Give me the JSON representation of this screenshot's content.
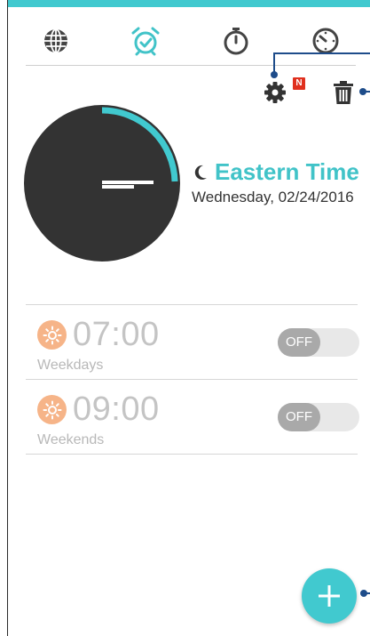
{
  "tabs": [
    {
      "icon": "globe-icon",
      "active": false
    },
    {
      "icon": "alarm-clock-icon",
      "active": true
    },
    {
      "icon": "stopwatch-icon",
      "active": false
    },
    {
      "icon": "timer-icon",
      "active": false
    }
  ],
  "toolbar": {
    "settings_icon": "gear-icon",
    "settings_badge": "N",
    "delete_icon": "trash-icon"
  },
  "clock": {
    "city_icon": "moon-icon",
    "city_name": "Eastern Time",
    "date": "Wednesday, 02/24/2016"
  },
  "alarms": [
    {
      "time": "07:00",
      "label": "Weekdays",
      "icon": "sun-icon",
      "toggle": "OFF",
      "enabled": false
    },
    {
      "time": "09:00",
      "label": "Weekends",
      "icon": "sun-icon",
      "toggle": "OFF",
      "enabled": false
    }
  ],
  "fab": {
    "icon": "plus-icon"
  },
  "colors": {
    "accent": "#41c9cf",
    "callout": "#1e4c8a",
    "badge": "#e0301e",
    "clock_face": "#333333",
    "sun": "#f6b488"
  }
}
